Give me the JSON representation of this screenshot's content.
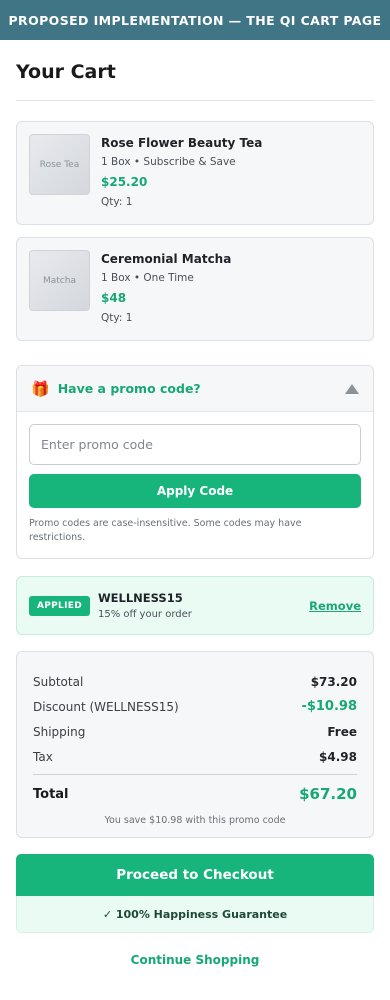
{
  "banner": {
    "text": "PROPOSED IMPLEMENTATION — THE QI CART PAGE"
  },
  "page": {
    "title": "Your Cart"
  },
  "items": [
    {
      "thumb_label": "Rose Tea",
      "name": "Rose Flower Beauty Tea",
      "variant": "1 Box • Subscribe & Save",
      "price": "$25.20",
      "qty": "Qty: 1"
    },
    {
      "thumb_label": "Matcha",
      "name": "Ceremonial Matcha",
      "variant": "1 Box • One Time",
      "price": "$48",
      "qty": "Qty: 1"
    }
  ],
  "promo": {
    "icon": "gift-icon",
    "header_label": "Have a promo code?",
    "input_placeholder": "Enter promo code",
    "input_value": "",
    "apply_label": "Apply Code",
    "note": "Promo codes are case-insensitive. Some codes may have restrictions.",
    "expanded": true
  },
  "applied": {
    "badge": "APPLIED",
    "code": "WELLNESS15",
    "description": "15% off your order",
    "remove_label": "Remove"
  },
  "summary": {
    "subtotal_label": "Subtotal",
    "subtotal_value": "$73.20",
    "discount_label": "Discount (WELLNESS15)",
    "discount_value": "-$10.98",
    "shipping_label": "Shipping",
    "shipping_value": "Free",
    "tax_label": "Tax",
    "tax_value": "$4.98",
    "total_label": "Total",
    "total_value": "$67.20",
    "savings_note": "You save $10.98 with this promo code"
  },
  "checkout": {
    "button_label": "Proceed to Checkout",
    "guarantee": "✓ 100% Happiness Guarantee",
    "continue_label": "Continue Shopping"
  },
  "colors": {
    "banner": "#3f7585",
    "accent": "#17b47c",
    "accent_text": "#17a874",
    "applied_bg": "#eafbf3"
  }
}
